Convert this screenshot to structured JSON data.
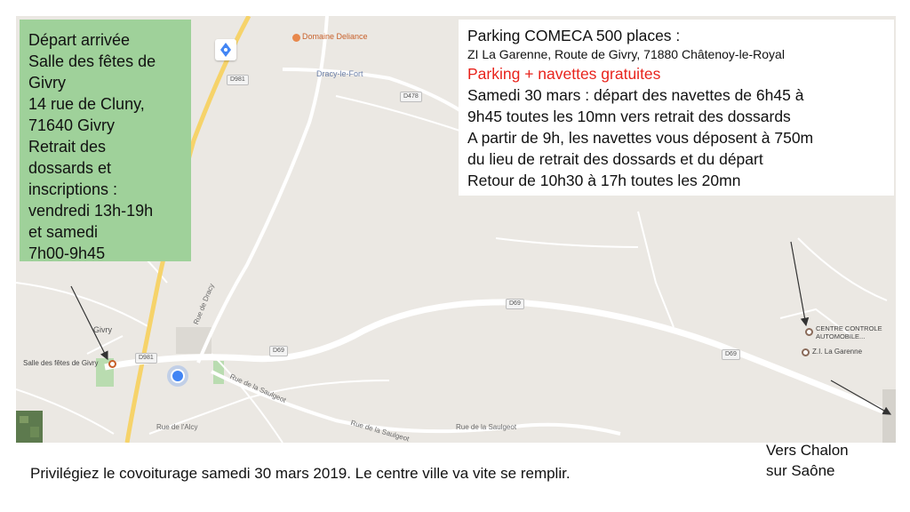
{
  "map": {
    "colors": {
      "land": "#ebe8e3",
      "road": "#ffffff",
      "main_road": "#f6d36a",
      "green": "#b9dcb0",
      "poi": "#e8884c",
      "blue": "#4285f4"
    },
    "labels": {
      "domaine": "Domaine Deliance",
      "dracy": "Dracy-le-Fort",
      "givry": "Givry",
      "salle": "Salle des fêtes de Givry",
      "centre_line1": "CENTRE CONTROLE",
      "centre_line2": "AUTOMOBILE...",
      "zi": "Z.I. La Garenne"
    },
    "road_shields": {
      "d981_top": "D981",
      "d478": "D478",
      "d69_mid": "D69",
      "d69_left": "D69",
      "d69_right": "D69",
      "d981_bottom": "D981"
    },
    "streets": {
      "rue_dracy": "Rue de Dracy",
      "rue_saulgeot_left": "Rue de la Saulgeot",
      "rue_saulgeot_mid": "Rue de la Saulgeot",
      "rue_saulgeot_right": "Rue de la Saulgeot",
      "rue_alcy": "Rue de l'Alcy"
    }
  },
  "green_box": {
    "lines": [
      "Départ arrivée",
      "Salle des fêtes de",
      "Givry",
      "14 rue de Cluny,",
      "71640 Givry",
      "Retrait des",
      "dossards et",
      "inscriptions :",
      "vendredi 13h-19h",
      "et samedi",
      "7h00-9h45"
    ]
  },
  "info_box": {
    "title": "Parking COMECA 500 places :",
    "address": "ZI La Garenne, Route de Givry, 71880 Châtenoy-le-Royal",
    "highlight": "Parking + navettes gratuites",
    "lines": [
      "Samedi 30 mars : départ des navettes de 6h45 à",
      "9h45 toutes les 10mn vers retrait des dossards",
      "A partir de 9h, les navettes vous déposent à 750m",
      "du lieu de retrait des dossards et du départ",
      "Retour de 10h30 à 17h toutes les 20mn"
    ]
  },
  "footer": {
    "note": "Privilégiez le covoiturage samedi 30 mars 2019. Le centre ville va vite se remplir.",
    "direction_line1": "Vers Chalon",
    "direction_line2": "sur Saône"
  },
  "icons": [
    "compass-icon",
    "poi-marker-icon",
    "location-dot-icon",
    "satellite-thumbnail"
  ]
}
